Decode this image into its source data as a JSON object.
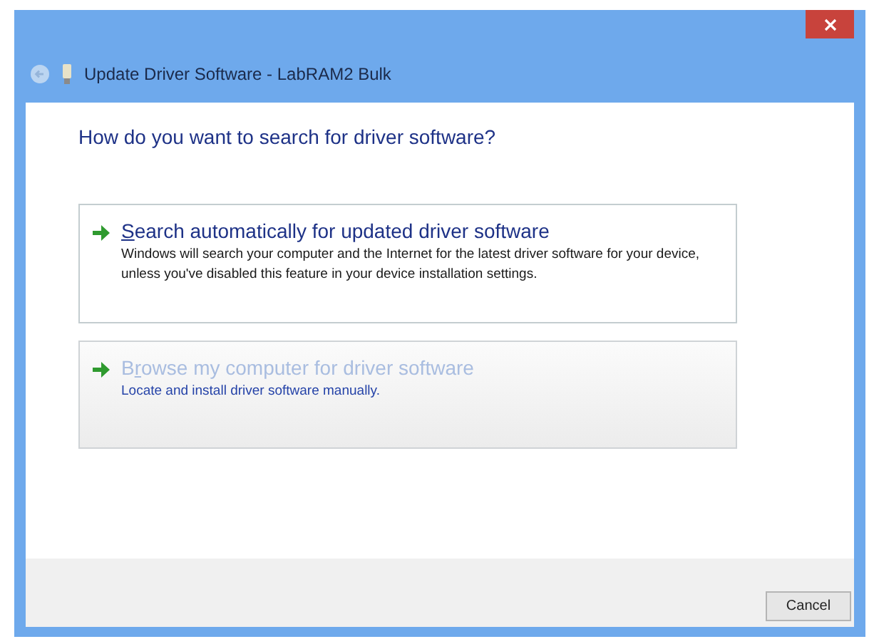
{
  "window": {
    "title": "Update Driver Software - LabRAM2 Bulk",
    "back_disabled": true
  },
  "heading": "How do you want to search for driver software?",
  "options": [
    {
      "access_key": "S",
      "title_rest": "earch automatically for updated driver software",
      "description": "Windows will search your computer and the Internet for the latest driver software for your device, unless you've disabled this feature in your device installation settings.",
      "hovered": false
    },
    {
      "title_start": "B",
      "access_key": "r",
      "title_rest": "owse my computer for driver software",
      "description": "Locate and install driver software manually.",
      "hovered": true
    }
  ],
  "buttons": [
    {
      "label": "Cancel"
    }
  ]
}
